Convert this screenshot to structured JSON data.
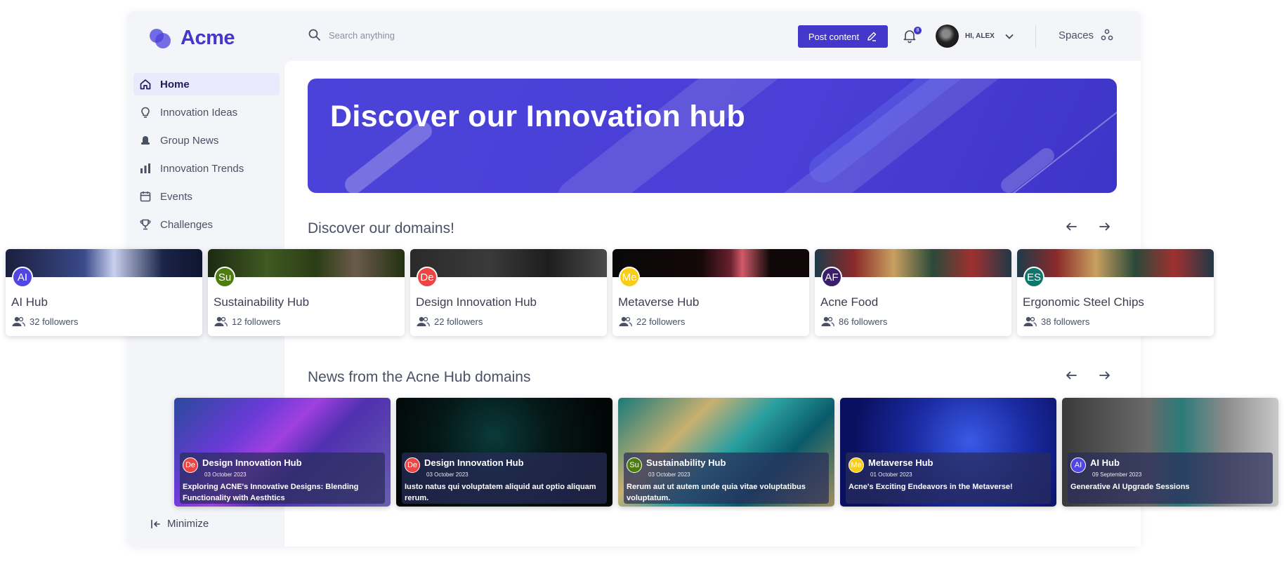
{
  "app": {
    "logo_text": "Acme"
  },
  "header": {
    "search_placeholder": "Search anything",
    "post_button": "Post content",
    "notification_count": "8",
    "user_greeting": "HI, ALEX",
    "spaces_label": "Spaces"
  },
  "sidebar": {
    "items": [
      {
        "label": "Home",
        "icon": "home-icon",
        "active": true
      },
      {
        "label": "Innovation Ideas",
        "icon": "lightbulb-icon"
      },
      {
        "label": "Group News",
        "icon": "news-icon"
      },
      {
        "label": "Innovation Trends",
        "icon": "bar-chart-icon"
      },
      {
        "label": "Events",
        "icon": "calendar-icon"
      },
      {
        "label": "Challenges",
        "icon": "trophy-icon"
      }
    ],
    "minimize_label": "Minimize"
  },
  "banner": {
    "title": "Discover our Innovation hub"
  },
  "domains": {
    "title": "Discover our domains!",
    "cards": [
      {
        "initials": "AI",
        "name": "AI Hub",
        "followers": "32 followers",
        "badge_color": "#4f46e5"
      },
      {
        "initials": "Su",
        "name": "Sustainability Hub",
        "followers": "12 followers",
        "badge_color": "#4d7c0f"
      },
      {
        "initials": "De",
        "name": "Design Innovation Hub",
        "followers": "22 followers",
        "badge_color": "#ef4444"
      },
      {
        "initials": "Me",
        "name": "Metaverse Hub",
        "followers": "22 followers",
        "badge_color": "#facc15"
      },
      {
        "initials": "AF",
        "name": "Acne Food",
        "followers": "86 followers",
        "badge_color": "#3b1f6e"
      },
      {
        "initials": "ES",
        "name": "Ergonomic Steel Chips",
        "followers": "38 followers",
        "badge_color": "#0f766e"
      }
    ]
  },
  "news": {
    "title": "News from the Acne Hub domains",
    "cards": [
      {
        "initials": "De",
        "hub": "Design Innovation Hub",
        "date": "03 October 2023",
        "headline": "Exploring ACNE's Innovative Designs: Blending Functionality with Aesthtics",
        "badge_color": "#ef4444"
      },
      {
        "initials": "De",
        "hub": "Design Innovation Hub",
        "date": "03 October 2023",
        "headline": "Iusto natus qui voluptatem aliquid aut optio aliquam rerum.",
        "badge_color": "#ef4444"
      },
      {
        "initials": "Su",
        "hub": "Sustainability Hub",
        "date": "03 October 2023",
        "headline": "Rerum aut ut autem unde quia vitae voluptatibus voluptatum.",
        "badge_color": "#4d7c0f"
      },
      {
        "initials": "Me",
        "hub": "Metaverse Hub",
        "date": "01 October 2023",
        "headline": "Acne's Exciting Endeavors in the Metaverse!",
        "badge_color": "#facc15"
      },
      {
        "initials": "AI",
        "hub": "AI Hub",
        "date": "09 September 2023",
        "headline": "Generative AI Upgrade Sessions",
        "badge_color": "#4f46e5"
      }
    ]
  },
  "colors": {
    "accent": "#4338ca",
    "banner": "#4b43d9"
  }
}
